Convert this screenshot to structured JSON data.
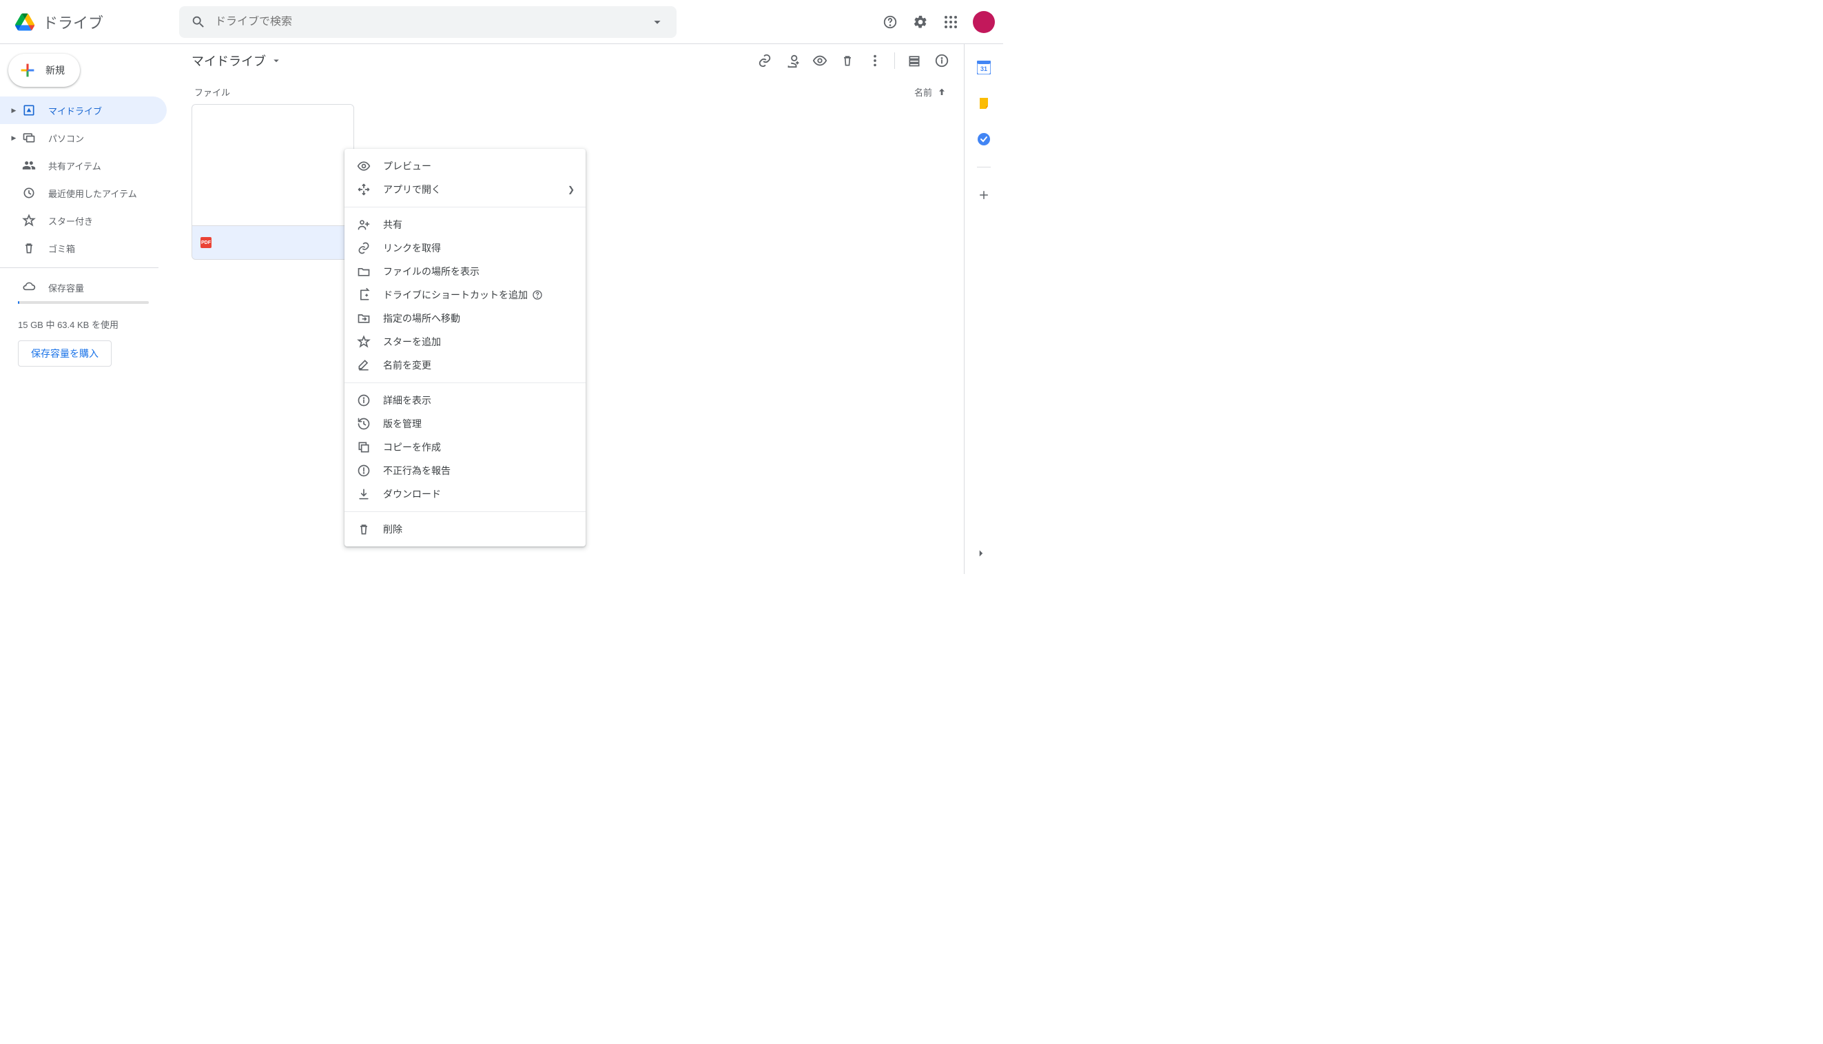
{
  "brand": "ドライブ",
  "search": {
    "placeholder": "ドライブで検索"
  },
  "new_button": "新規",
  "sidebar": {
    "items": [
      {
        "label": "マイドライブ"
      },
      {
        "label": "パソコン"
      },
      {
        "label": "共有アイテム"
      },
      {
        "label": "最近使用したアイテム"
      },
      {
        "label": "スター付き"
      },
      {
        "label": "ゴミ箱"
      }
    ],
    "storage_label": "保存容量",
    "storage_usage": "15 GB 中 63.4 KB を使用",
    "buy_storage": "保存容量を購入"
  },
  "breadcrumb": "マイドライブ",
  "section": {
    "files_label": "ファイル",
    "sort_label": "名前"
  },
  "file": {
    "badge": "PDF"
  },
  "context_menu": {
    "preview": "プレビュー",
    "open_with": "アプリで開く",
    "share": "共有",
    "get_link": "リンクを取得",
    "show_location": "ファイルの場所を表示",
    "add_shortcut": "ドライブにショートカットを追加",
    "move_to": "指定の場所へ移動",
    "add_star": "スターを追加",
    "rename": "名前を変更",
    "details": "詳細を表示",
    "manage_versions": "版を管理",
    "make_copy": "コピーを作成",
    "report_abuse": "不正行為を報告",
    "download": "ダウンロード",
    "remove": "削除"
  }
}
